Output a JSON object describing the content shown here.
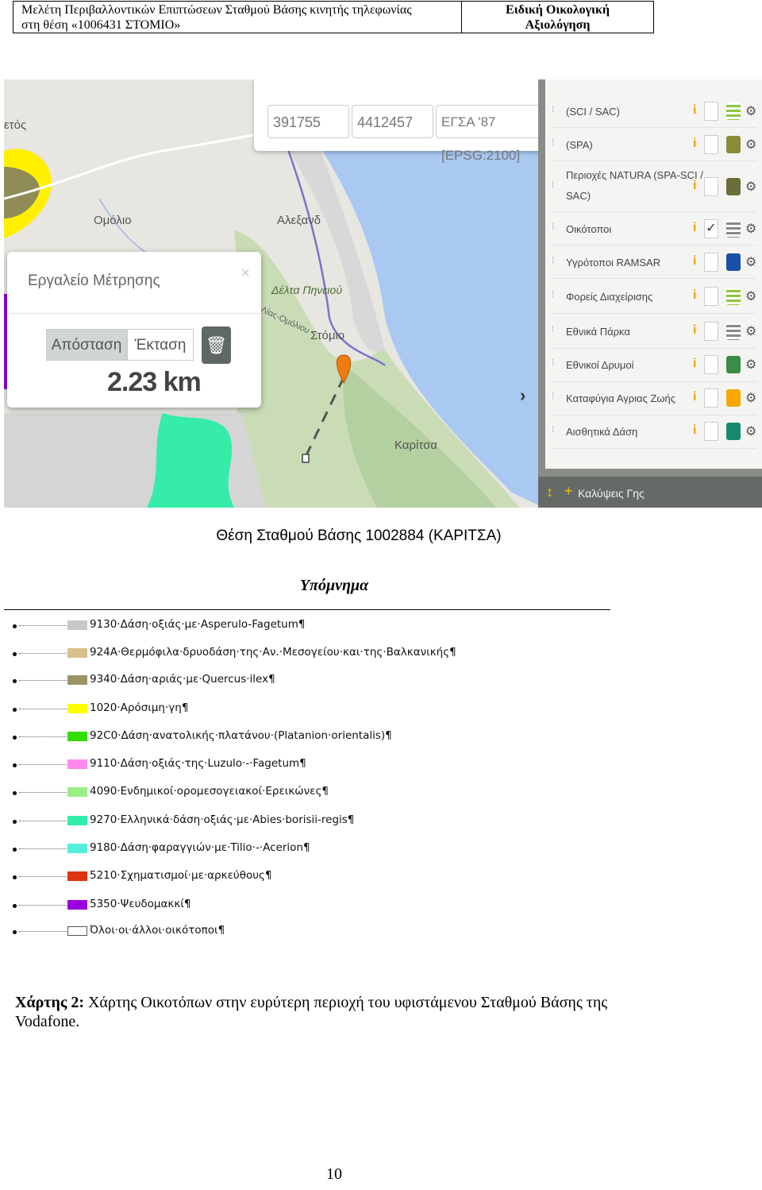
{
  "header": {
    "left_line1": "Μελέτη Περιβαλλοντικών Επιπτώσεων Σταθμού Βάσης κινητής τηλεφωνίας",
    "left_line2": "στη θέση «1006431 ΣΤΟΜΙΟ»",
    "right_line1": "Ειδική Οικολογική",
    "right_line2": "Αξιολόγηση"
  },
  "map": {
    "search": {
      "x_value": "391755",
      "y_value": "4412457",
      "crs": "ΕΓΣΑ '87 [EPSG:2100]"
    },
    "place_labels": [
      "ετός",
      "Ομόλιο",
      "Αλεξανδ",
      "Δέλτα Πηνειού",
      "Λίας-Ομόλιου",
      "Στόμιο",
      "Καρίτσα"
    ],
    "measure_tool": {
      "title": "Εργαλείο Μέτρησης",
      "close": "×",
      "btn_distance": "Απόσταση",
      "btn_area": "Έκταση",
      "value": "2.23 km"
    },
    "layers": [
      {
        "name": "(SCI / SAC)",
        "color": "#8dc63f",
        "checked": false,
        "icon": "list"
      },
      {
        "name": "(SPA)",
        "color": "#8a8c3a",
        "checked": false,
        "icon": "fill"
      },
      {
        "name": "Περιοχές NATURA (SPA-SCI /",
        "name2": "SAC)",
        "color": "#6b6e3b",
        "checked": false,
        "icon": "fill"
      },
      {
        "name": "Οικότοποι",
        "color": "#888888",
        "checked": true,
        "icon": "list"
      },
      {
        "name": "Υγρότοποι RAMSAR",
        "color": "#1a4fa8",
        "checked": false,
        "icon": "fill"
      },
      {
        "name": "Φορείς Διαχείρισης",
        "color": "#8dc63f",
        "checked": false,
        "icon": "list"
      },
      {
        "name": "Εθνικά Πάρκα",
        "color": "#888888",
        "checked": false,
        "icon": "list"
      },
      {
        "name": "Εθνικοί Δρυμοί",
        "color": "#3b8c44",
        "checked": false,
        "icon": "fill"
      },
      {
        "name": "Καταφύγια Αγριας Ζωής",
        "color": "#f7a800",
        "checked": false,
        "icon": "fill"
      },
      {
        "name": "Αισθητικά Δάση",
        "color": "#138a6e",
        "checked": false,
        "icon": "fill"
      }
    ],
    "land_cover_label": "Καλύψεις Γης"
  },
  "map_caption": "Θέση Σταθμού Βάσης 1002884 (ΚΑΡΙΤΣΑ)",
  "legend": {
    "title": "Υπόμνημα",
    "items": [
      {
        "label": "9130·Δάση·οξιάς·με·Asperulo-Fagetum¶",
        "color": "#c8c8c8"
      },
      {
        "label": "924Α·Θερμόφιλα·δρυοδάση·της·Αν.·Μεσογείου·και·της·Βαλκανικής¶",
        "color": "#d9bf8c"
      },
      {
        "label": "9340·Δάση·αριάς·με·Quercus·ilex¶",
        "color": "#9b9466"
      },
      {
        "label": "1020·Αρόσιμη·γη¶",
        "color": "#ffff00"
      },
      {
        "label": "92C0·Δάση·ανατολικής·πλατάνου·(Platanion·orientalis)¶",
        "color": "#33dd00"
      },
      {
        "label": "9110·Δάση·οξιάς·της·Luzulo·-·Fagetum¶",
        "color": "#ff88ee"
      },
      {
        "label": "4090·Ενδημικοί·ορομεσογειακοί·Ερεικώνες¶",
        "color": "#99ee88"
      },
      {
        "label": "9270·Ελληνικά·δάση·οξιάς·με·Abies·borisii-regis¶",
        "color": "#33eeaa"
      },
      {
        "label": "9180·Δάση·φαραγγιών·με·Tilio·-·Acerion¶",
        "color": "#55eedd"
      },
      {
        "label": "5210·Σχηματισμοί·με·αρκεύθους¶",
        "color": "#dd3311"
      },
      {
        "label": "5350·Ψευδομακκί¶",
        "color": "#9900dd"
      },
      {
        "label": "Όλοι·οι·άλλοι·οικότοποι¶",
        "color": "#ffffff"
      }
    ]
  },
  "figure_caption": {
    "label": "Χάρτης 2:",
    "text": "Χάρτης Οικοτόπων στην ευρύτερη περιοχή του υφιστάμενου Σταθμού Βάσης της Vodafone."
  },
  "page_number": "10"
}
